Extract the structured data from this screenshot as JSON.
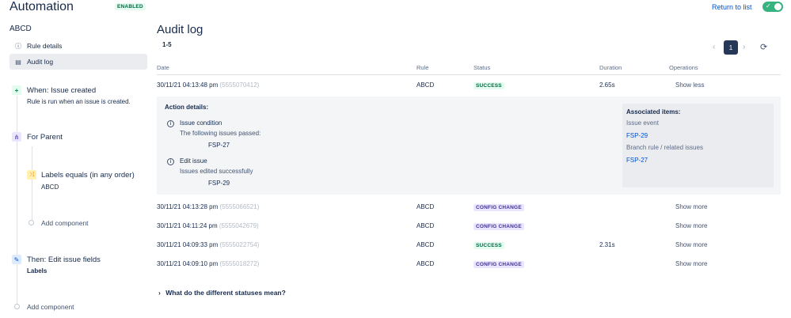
{
  "header": {
    "title": "Automation",
    "status_badge": "ENABLED",
    "return_link": "Return to list",
    "toggle_state": "on",
    "toggle_check": "✓"
  },
  "sidebar": {
    "rule_name": "ABCD",
    "items": [
      {
        "label": "Rule details",
        "icon": "info-icon",
        "glyph": "ⓘ"
      },
      {
        "label": "Audit log",
        "icon": "document-icon",
        "glyph": "▤"
      }
    ],
    "trigger": {
      "title": "When: Issue created",
      "subtitle": "Rule is run when an issue is created.",
      "glyph": "+"
    },
    "branch": {
      "title": "For Parent",
      "glyph": "⋔"
    },
    "condition": {
      "title": "Labels equals (in any order)",
      "subtitle": "ABCD",
      "glyph": "⤨"
    },
    "add_component_inner": "Add component",
    "action": {
      "title": "Then: Edit issue fields",
      "subtitle": "Labels",
      "glyph": "✎"
    },
    "add_component_outer": "Add component"
  },
  "main": {
    "title": "Audit log",
    "range": "1-5",
    "pagination": {
      "current_page": "1",
      "prev_glyph": "‹",
      "next_glyph": "›",
      "refresh_glyph": "⟳"
    },
    "columns": [
      "Date",
      "Rule",
      "Status",
      "Duration",
      "Operations"
    ],
    "rows": [
      {
        "date": "30/11/21 04:13:48 pm",
        "id": "(5555070412)",
        "rule": "ABCD",
        "status": "SUCCESS",
        "status_color": "#006644",
        "duration": "2.65s",
        "operation": "Show less"
      },
      {
        "date": "30/11/21 04:13:28 pm",
        "id": "(5555066521)",
        "rule": "ABCD",
        "status": "CONFIG CHANGE",
        "status_color": "#403294",
        "duration": "",
        "operation": "Show more"
      },
      {
        "date": "30/11/21 04:11:24 pm",
        "id": "(5555042679)",
        "rule": "ABCD",
        "status": "CONFIG CHANGE",
        "status_color": "#403294",
        "duration": "",
        "operation": "Show more"
      },
      {
        "date": "30/11/21 04:09:33 pm",
        "id": "(5555022754)",
        "rule": "ABCD",
        "status": "SUCCESS",
        "status_color": "#006644",
        "duration": "2.31s",
        "operation": "Show more"
      },
      {
        "date": "30/11/21 04:09:10 pm",
        "id": "(5555018272)",
        "rule": "ABCD",
        "status": "CONFIG CHANGE",
        "status_color": "#403294",
        "duration": "",
        "operation": "Show more"
      }
    ],
    "details": {
      "title": "Action details:",
      "actions": [
        {
          "name": "Issue condition",
          "message": "The following issues passed:",
          "issue": "FSP-27"
        },
        {
          "name": "Edit issue",
          "message": "Issues edited successfully",
          "issue": "FSP-29"
        }
      ],
      "associated": {
        "title": "Associated items:",
        "groups": [
          {
            "label": "Issue event",
            "link": "FSP-29"
          },
          {
            "label": "Branch rule / related issues",
            "link": "FSP-27"
          }
        ]
      }
    },
    "faq": "What do the different statuses mean?",
    "faq_glyph": "›"
  }
}
